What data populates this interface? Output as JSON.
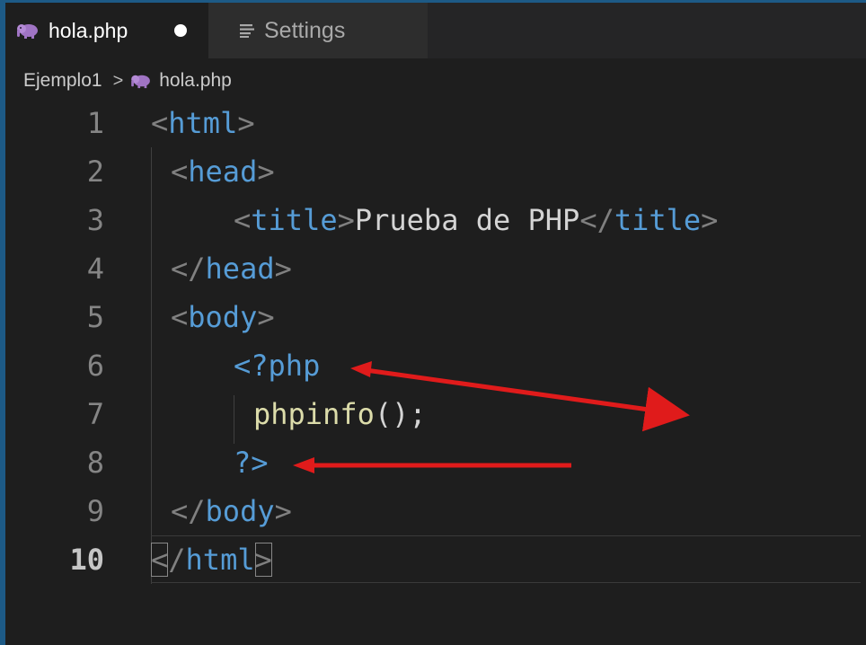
{
  "tabs": [
    {
      "label": "hola.php",
      "active": true,
      "modified": true,
      "icon": "php-elephant-icon"
    },
    {
      "label": "Settings",
      "active": false,
      "icon": "settings-list-icon"
    }
  ],
  "breadcrumb": {
    "folder": "Ejemplo1",
    "separator": ">",
    "file": "hola.php"
  },
  "editor": {
    "current_line": 10,
    "lines": [
      {
        "number": "1",
        "tokens": [
          [
            "tagpunct",
            "<"
          ],
          [
            "tagname",
            "html"
          ],
          [
            "tagpunct",
            ">"
          ]
        ],
        "indent": 0
      },
      {
        "number": "2",
        "tokens": [
          [
            "tagpunct",
            "<"
          ],
          [
            "tagname",
            "head"
          ],
          [
            "tagpunct",
            ">"
          ]
        ],
        "indent": 1
      },
      {
        "number": "3",
        "tokens": [
          [
            "tagpunct",
            "<"
          ],
          [
            "tagname",
            "title"
          ],
          [
            "tagpunct",
            ">"
          ],
          [
            "text",
            "Prueba de PHP"
          ],
          [
            "tagpunct",
            "</"
          ],
          [
            "tagname",
            "title"
          ],
          [
            "tagpunct",
            ">"
          ]
        ],
        "indent": 2
      },
      {
        "number": "4",
        "tokens": [
          [
            "tagpunct",
            "</"
          ],
          [
            "tagname",
            "head"
          ],
          [
            "tagpunct",
            ">"
          ]
        ],
        "indent": 1
      },
      {
        "number": "5",
        "tokens": [
          [
            "tagpunct",
            "<"
          ],
          [
            "tagname",
            "body"
          ],
          [
            "tagpunct",
            ">"
          ]
        ],
        "indent": 1
      },
      {
        "number": "6",
        "tokens": [
          [
            "php",
            "<?php"
          ]
        ],
        "indent": 2
      },
      {
        "number": "7",
        "tokens": [
          [
            "fn",
            "phpinfo"
          ],
          [
            "text",
            "();"
          ]
        ],
        "indent": 3
      },
      {
        "number": "8",
        "tokens": [
          [
            "php",
            "?>"
          ]
        ],
        "indent": 2
      },
      {
        "number": "9",
        "tokens": [
          [
            "tagpunct",
            "</"
          ],
          [
            "tagname",
            "body"
          ],
          [
            "tagpunct",
            ">"
          ]
        ],
        "indent": 1
      },
      {
        "number": "10",
        "tokens": [
          [
            "tagpunct",
            "</"
          ],
          [
            "tagname",
            "html"
          ],
          [
            "tagpunct",
            ">"
          ]
        ],
        "indent": 0
      }
    ]
  },
  "annotations": {
    "arrow_color": "#e01b1b",
    "arrows": [
      {
        "points_to_line": "6",
        "label": "php-open-tag"
      },
      {
        "points_to_line": "8",
        "label": "php-close-tag"
      }
    ]
  },
  "colors": {
    "editor_bg": "#1e1e1e",
    "frame": "#1d5a86",
    "tag_name": "#569cd6",
    "tag_punct": "#808080",
    "function": "#dcdcaa",
    "text": "#d4d4d4"
  }
}
